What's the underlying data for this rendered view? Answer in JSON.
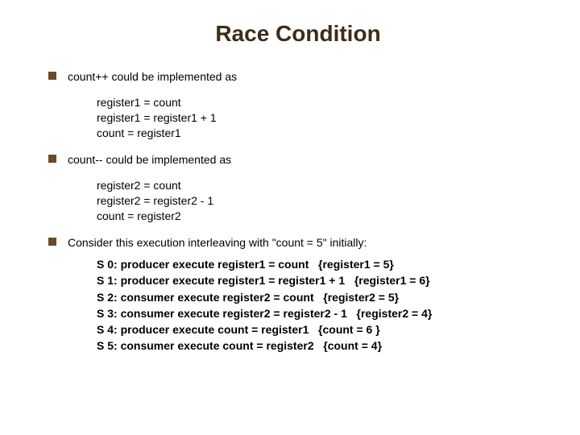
{
  "title": "Race Condition",
  "bullet1": "count++ could be implemented as",
  "code1": {
    "l1": "register1 = count",
    "l2": "register1 = register1 + 1",
    "l3": "count = register1"
  },
  "bullet2": "count-- could be implemented as",
  "code2": {
    "l1": "register2 = count",
    "l2": "register2 = register2 - 1",
    "l3": "count = register2"
  },
  "bullet3": "Consider this execution interleaving with \"count = 5\" initially:",
  "steps": {
    "s0": "S 0: producer execute register1 = count   {register1 = 5}",
    "s1": "S 1: producer execute register1 = register1 + 1   {register1 = 6}",
    "s2": "S 2: consumer execute register2 = count   {register2 = 5}",
    "s3": "S 3: consumer execute register2 = register2 - 1   {register2 = 4}",
    "s4": "S 4: producer execute count = register1   {count = 6 }",
    "s5": "S 5: consumer execute count = register2   {count = 4}"
  }
}
